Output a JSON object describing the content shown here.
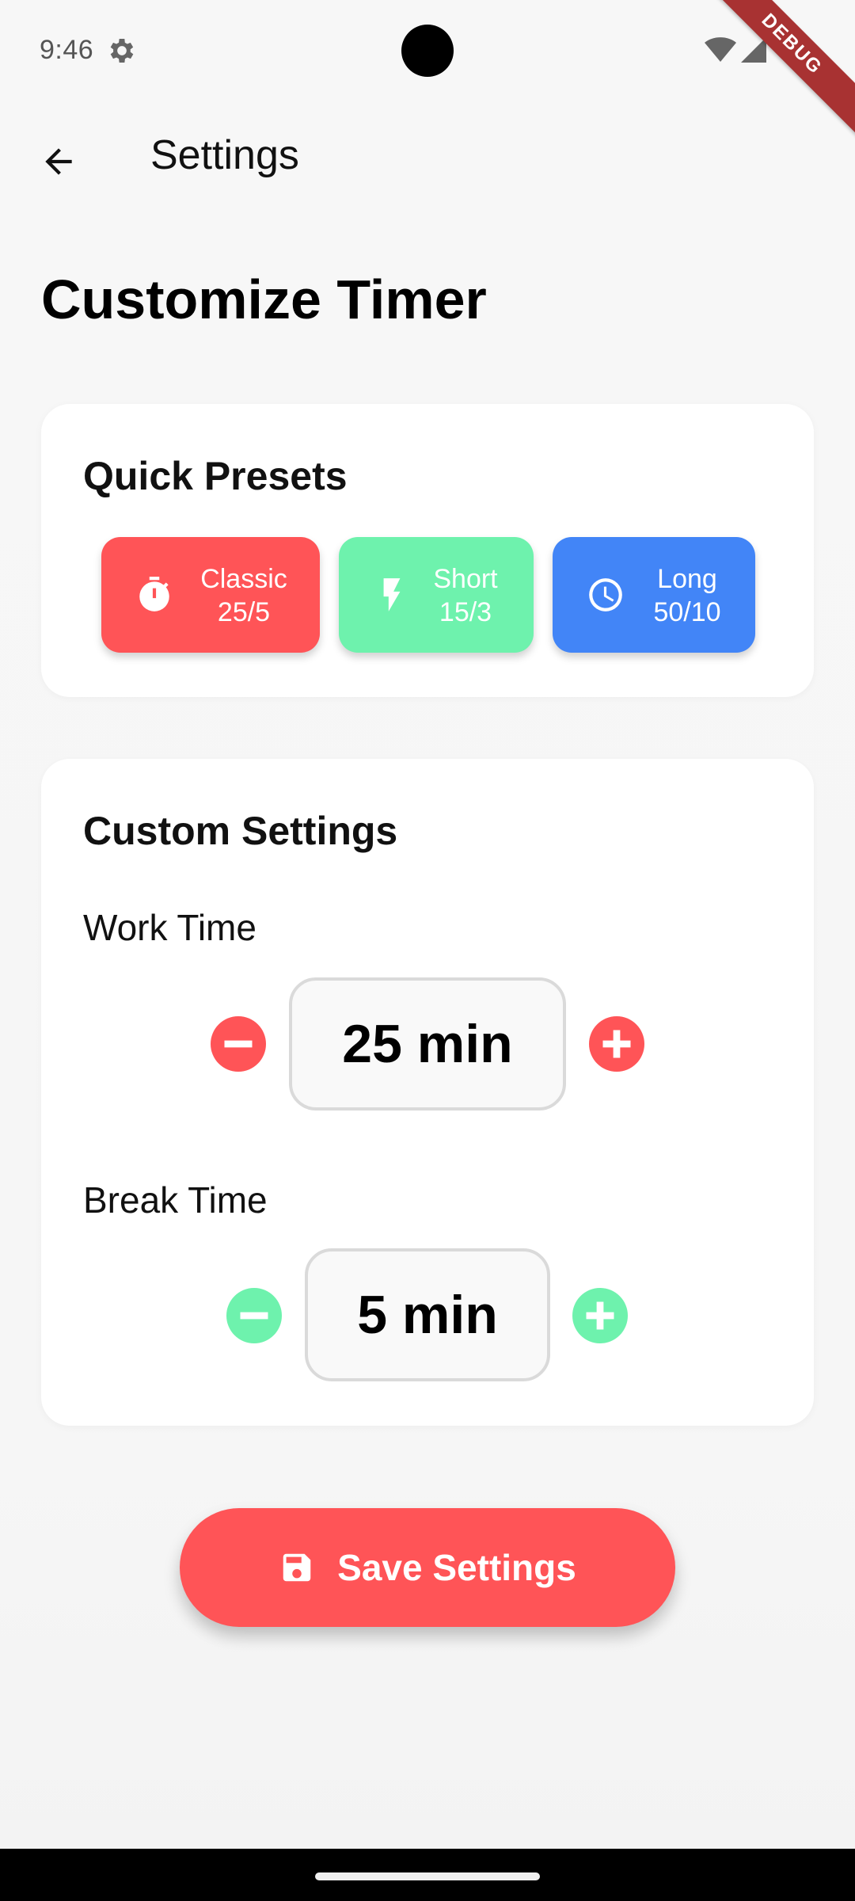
{
  "status_bar": {
    "time": "9:46",
    "debug_label": "DEBUG"
  },
  "app_bar": {
    "title": "Settings",
    "back_icon": "arrow-back-icon"
  },
  "page": {
    "heading": "Customize Timer"
  },
  "presets": {
    "title": "Quick Presets",
    "items": [
      {
        "name": "Classic",
        "value": "25/5",
        "icon": "timer-icon",
        "color": "#ff5457"
      },
      {
        "name": "Short",
        "value": "15/3",
        "icon": "lightning-bolt-icon",
        "color": "#6ef2ad"
      },
      {
        "name": "Long",
        "value": "50/10",
        "icon": "clock-icon",
        "color": "#4285f7"
      }
    ]
  },
  "custom": {
    "title": "Custom Settings",
    "work": {
      "label": "Work Time",
      "value": "25 min",
      "accent": "#ff5457"
    },
    "break": {
      "label": "Break Time",
      "value": "5 min",
      "accent": "#6ef2ad"
    }
  },
  "save": {
    "label": "Save Settings",
    "icon": "save-icon",
    "color": "#ff5457"
  }
}
